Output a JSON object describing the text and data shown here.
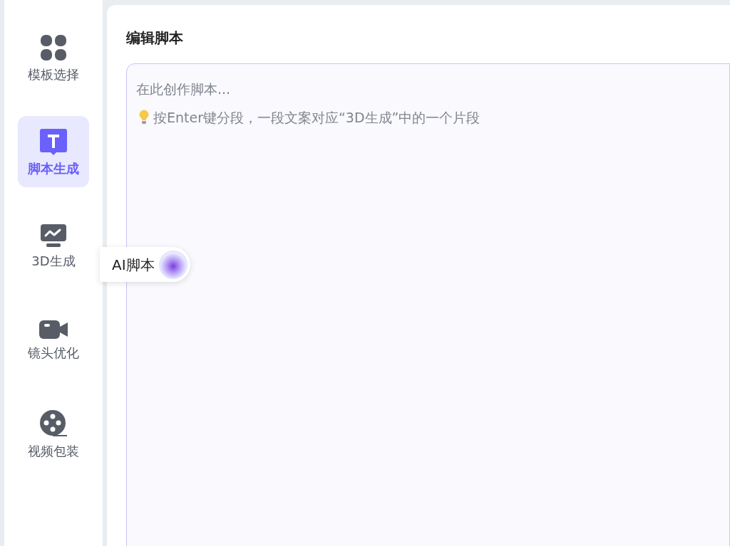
{
  "sidebar": {
    "items": [
      {
        "label": "模板选择",
        "kind": "grid",
        "selected": false
      },
      {
        "label": "脚本生成",
        "kind": "text",
        "selected": true
      },
      {
        "label": "3D生成",
        "kind": "monitor",
        "selected": false
      },
      {
        "label": "镜头优化",
        "kind": "camera",
        "selected": false
      },
      {
        "label": "视频包装",
        "kind": "reel",
        "selected": false
      }
    ]
  },
  "editor": {
    "title": "编辑脚本",
    "placeholder": "在此创作脚本...",
    "hint": "按Enter键分段，一段文案对应“3D生成”中的一个片段"
  },
  "ai_button": {
    "label": "AI脚本"
  }
}
